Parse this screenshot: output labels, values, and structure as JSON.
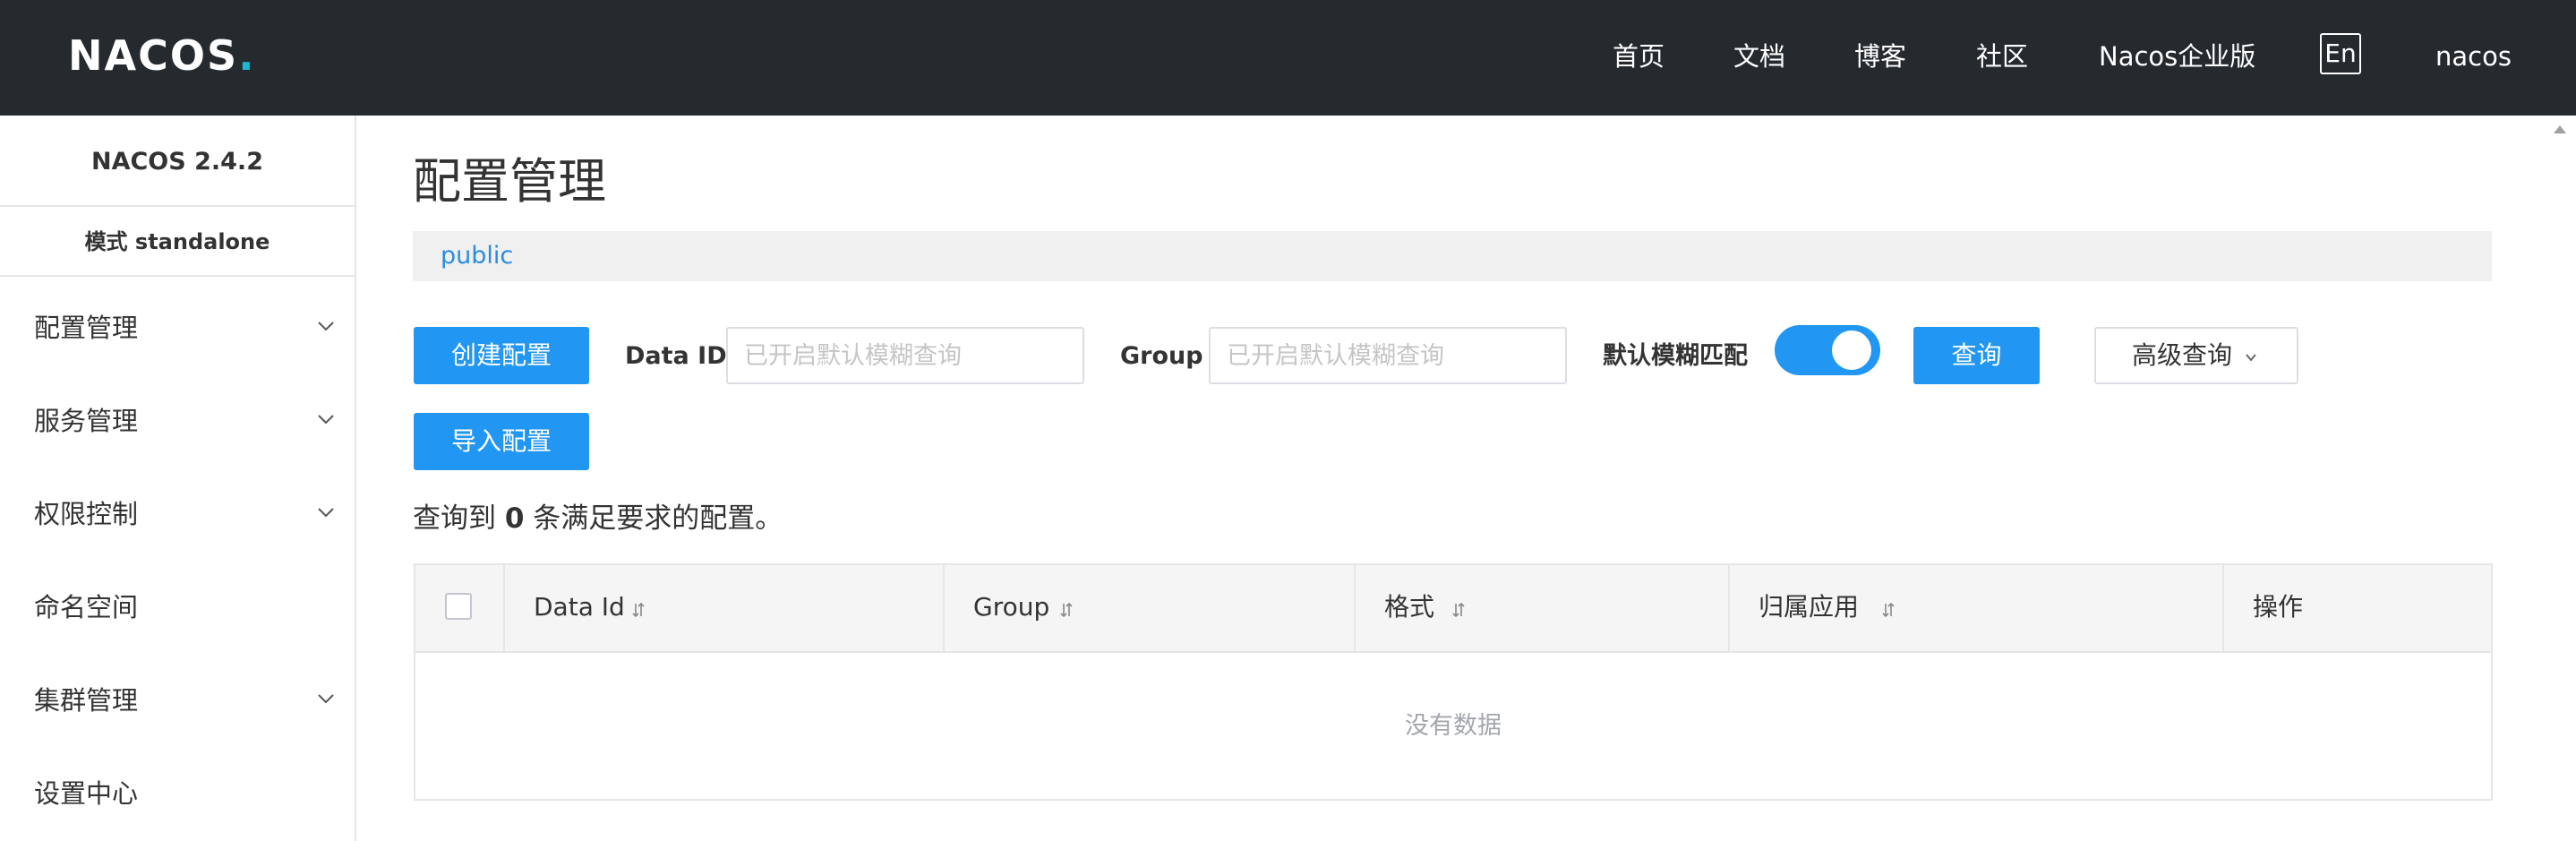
{
  "header": {
    "logo_text": "NACOS",
    "logo_dot": ".",
    "nav": [
      "首页",
      "文档",
      "博客",
      "社区",
      "Nacos企业版"
    ],
    "lang_label": "En",
    "user": "nacos"
  },
  "sidebar": {
    "version": "NACOS 2.4.2",
    "mode": "模式 standalone",
    "items": [
      {
        "label": "配置管理",
        "expandable": true
      },
      {
        "label": "服务管理",
        "expandable": true
      },
      {
        "label": "权限控制",
        "expandable": true
      },
      {
        "label": "命名空间",
        "expandable": false
      },
      {
        "label": "集群管理",
        "expandable": true
      },
      {
        "label": "设置中心",
        "expandable": false
      }
    ]
  },
  "main": {
    "title": "配置管理",
    "namespace": "public",
    "create_button": "创建配置",
    "import_button": "导入配置",
    "data_id_label": "Data ID",
    "data_id_placeholder": "已开启默认模糊查询",
    "group_label": "Group",
    "group_placeholder": "已开启默认模糊查询",
    "fuzzy_label": "默认模糊匹配",
    "fuzzy_enabled": true,
    "query_button": "查询",
    "advanced_button": "高级查询",
    "result_prefix": "查询到",
    "result_count": "0",
    "result_suffix": "条满足要求的配置。"
  },
  "table": {
    "columns": [
      "Data Id",
      "Group",
      "格式",
      "归属应用",
      "操作"
    ],
    "empty_text": "没有数据",
    "rows": []
  },
  "colors": {
    "header_bg": "#252a2f",
    "primary": "#2196f3",
    "link": "#2b8ce0",
    "logo_accent": "#1cb7d1"
  }
}
